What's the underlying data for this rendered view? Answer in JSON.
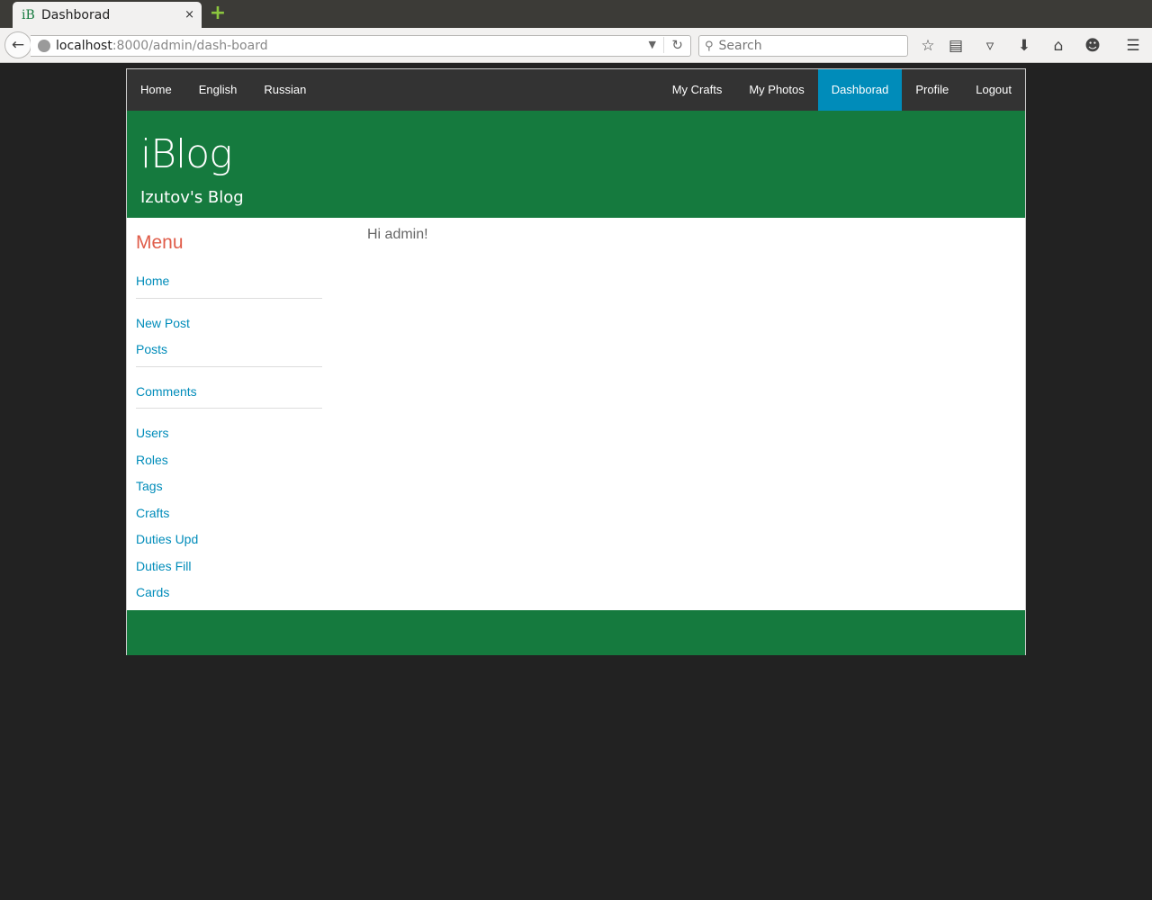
{
  "browser": {
    "tab_title": "Dashborad",
    "tab_favicon": "iB",
    "tab_close": "×",
    "new_tab": "+",
    "url_host": "localhost",
    "url_path": ":8000/admin/dash-board",
    "search_placeholder": "Search"
  },
  "nav": {
    "left": [
      "Home",
      "English",
      "Russian"
    ],
    "right": [
      "My Crafts",
      "My Photos",
      "Dashborad",
      "Profile",
      "Logout"
    ],
    "active": "Dashborad"
  },
  "header": {
    "title": "iBlog",
    "subtitle": "Izutov's Blog"
  },
  "sidebar": {
    "title": "Menu",
    "groups": [
      [
        "Home"
      ],
      [
        "New Post",
        "Posts"
      ],
      [
        "Comments"
      ],
      [
        "Users",
        "Roles",
        "Tags",
        "Crafts",
        "Duties Upd",
        "Duties Fill",
        "Cards"
      ]
    ]
  },
  "main": {
    "greeting": "Hi admin!"
  },
  "colors": {
    "brand_green": "#157a3e",
    "nav_dark": "#333333",
    "active_blue": "#008cba",
    "menu_title_red": "#e05d4a"
  }
}
